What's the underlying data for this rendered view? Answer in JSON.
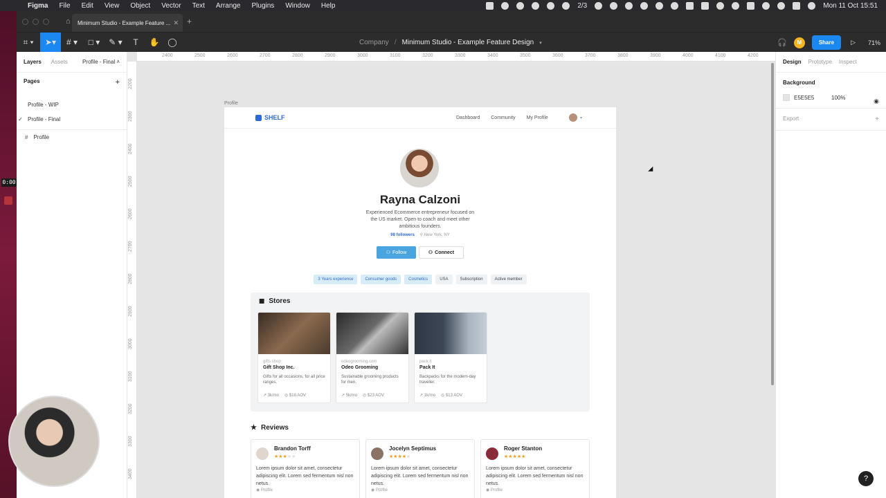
{
  "menubar": {
    "app_name": "Figma",
    "items": [
      "File",
      "Edit",
      "View",
      "Object",
      "Vector",
      "Text",
      "Arrange",
      "Plugins",
      "Window",
      "Help"
    ],
    "status_text": "2/3",
    "clock": "Mon 11 Oct  15:51"
  },
  "recording": {
    "timer": "0:00"
  },
  "window": {
    "tab_title": "Minimum Studio - Example Feature ...",
    "breadcrumb_team": "Company",
    "breadcrumb_sep": "/",
    "document_title": "Minimum Studio - Example Feature Design",
    "share_label": "Share",
    "avatar_initial": "M",
    "zoom": "71%"
  },
  "left_panel": {
    "tabs": [
      "Layers",
      "Assets"
    ],
    "current_page": "Profile - Final",
    "pages_header": "Pages",
    "pages": [
      {
        "label": "Profile - WIP",
        "checked": false
      },
      {
        "label": "Profile - Final",
        "checked": true
      }
    ],
    "layers": [
      "Profile"
    ]
  },
  "canvas": {
    "ruler_h": [
      "2400",
      "2500",
      "2600",
      "2700",
      "2800",
      "2900",
      "3000",
      "3100",
      "3200",
      "3300",
      "3400",
      "3500",
      "3600",
      "3700",
      "3800",
      "3900",
      "4000",
      "4100",
      "4200"
    ],
    "ruler_v": [
      "2200",
      "2300",
      "2400",
      "2500",
      "2600",
      "2700",
      "2800",
      "2900",
      "3000",
      "3100",
      "3200",
      "3300",
      "3400"
    ],
    "frame_label": "Profile"
  },
  "site": {
    "logo": "SHELF",
    "nav": [
      "Dashboard",
      "Community",
      "My Profile"
    ],
    "profile": {
      "name": "Rayna Calzoni",
      "bio": "Experienced Ecommerce entrepreneur focused on the US market. Open to coach and meet other ambitious founders.",
      "followers": "98 followers",
      "location": "New York, NY",
      "follow_label": "Follow",
      "connect_label": "Connect"
    },
    "tags": [
      {
        "label": "3 Years experience",
        "highlight": true
      },
      {
        "label": "Consumer goods",
        "highlight": true
      },
      {
        "label": "Cosmetics",
        "highlight": true
      },
      {
        "label": "USA",
        "highlight": false
      },
      {
        "label": "Subscription",
        "highlight": false
      },
      {
        "label": "Active member",
        "highlight": false
      }
    ],
    "stores_title": "Stores",
    "stores": [
      {
        "domain": "gifts.shop",
        "name": "Gift Shop Inc.",
        "desc": "Gifts for all occasions, for all price ranges.",
        "visits": "3k/mo",
        "aov": "$18 AOV",
        "img_color": "#5a4536"
      },
      {
        "domain": "odeogrooming.com",
        "name": "Odeo Grooming",
        "desc": "Sustainable grooming products for men.",
        "visits": "5k/mo",
        "aov": "$23 AOV",
        "img_color": "#3c3c3c"
      },
      {
        "domain": "pack.it",
        "name": "Pack It",
        "desc": "Backpacks for the modern-day traveller.",
        "visits": "1k/mo",
        "aov": "$13 AOV",
        "img_color": "#3a4452"
      }
    ],
    "reviews_title": "Reviews",
    "reviews": [
      {
        "name": "Brandon Torff",
        "stars": 3,
        "text": "Lorem ipsum dolor sit amet, consectetur adipiscing elit. Lorem sed fermentum nisl non netus.",
        "link": "Profile"
      },
      {
        "name": "Jocelyn Septimus",
        "stars": 4,
        "text": "Lorem ipsum dolor sit amet, consectetur adipiscing elit. Lorem sed fermentum nisl non netus.",
        "link": "Profile"
      },
      {
        "name": "Roger Stanton",
        "stars": 5,
        "text": "Lorem ipsum dolor sit amet, consectetur adipiscing elit. Lorem sed fermentum nisl non netus.",
        "link": "Profile"
      }
    ]
  },
  "right_panel": {
    "tabs": [
      "Design",
      "Prototype",
      "Inspect"
    ],
    "background_header": "Background",
    "bg_hex": "E5E5E5",
    "bg_opacity": "100%",
    "export_header": "Export"
  },
  "colors": {
    "figma_blue": "#1a88f0",
    "brand_blue": "#2f6bd8",
    "canvas_bg": "#e5e5e5",
    "star": "#f0a020"
  }
}
